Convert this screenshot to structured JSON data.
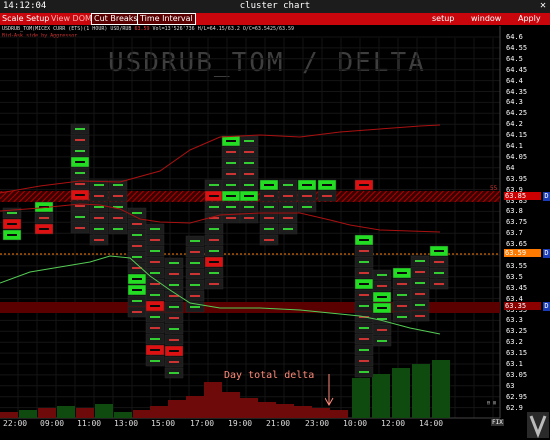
{
  "titlebar": {
    "time": "14:12:04",
    "title": "cluster chart",
    "close": "✕"
  },
  "menu": {
    "scale_setup": "Scale Setup",
    "view_dom": "View DOM",
    "cut_breaks": "Cut Breaks",
    "time_interval": "Time Interval",
    "setup": "setup",
    "window": "window",
    "apply": "Apply"
  },
  "info": {
    "line1": "USDRUB_TOM(MICEX CURR (ETS)(1 HOUR) USD/RUB",
    "line1_price": "63.59",
    "line1_rest": "Vol=13'526'736 H/L=64.15/63.2 O/C=63.5425/63.59",
    "line2": "Bid-Ask side by Aggressor"
  },
  "watermark": "USDRUB_TOM / DELTA",
  "annotation": "Day total delta",
  "red_level_label": "55",
  "fix_label": "FIX",
  "price_axis": {
    "labels": [
      "64.6",
      "64.55",
      "64.5",
      "64.45",
      "64.4",
      "64.35",
      "64.3",
      "64.25",
      "64.2",
      "64.15",
      "64.1",
      "64.05",
      "64",
      "63.95",
      "63.9",
      "63.85",
      "63.8",
      "63.75",
      "63.7",
      "63.65",
      "63.6",
      "63.55",
      "63.5",
      "63.45",
      "63.4",
      "63.35",
      "63.3",
      "63.25",
      "63.2",
      "63.15",
      "63.1",
      "63.05",
      "63",
      "62.95",
      "62.9"
    ],
    "tags": [
      {
        "value": "63.85",
        "style": "red"
      },
      {
        "value": "63.59",
        "style": "orange"
      },
      {
        "value": "63.35",
        "style": "darkred"
      }
    ],
    "d_marker": "D"
  },
  "time_axis": [
    "22:00",
    "09:00",
    "11:00",
    "13:00",
    "15:00",
    "17:00",
    "19:00",
    "21:00",
    "23:00",
    "10:00",
    "12:00",
    "14:00"
  ],
  "colors": {
    "menu_red": "#c8060c",
    "buy": "#22dd22",
    "sell": "#dd2222",
    "orange": "#ff7a00"
  }
}
